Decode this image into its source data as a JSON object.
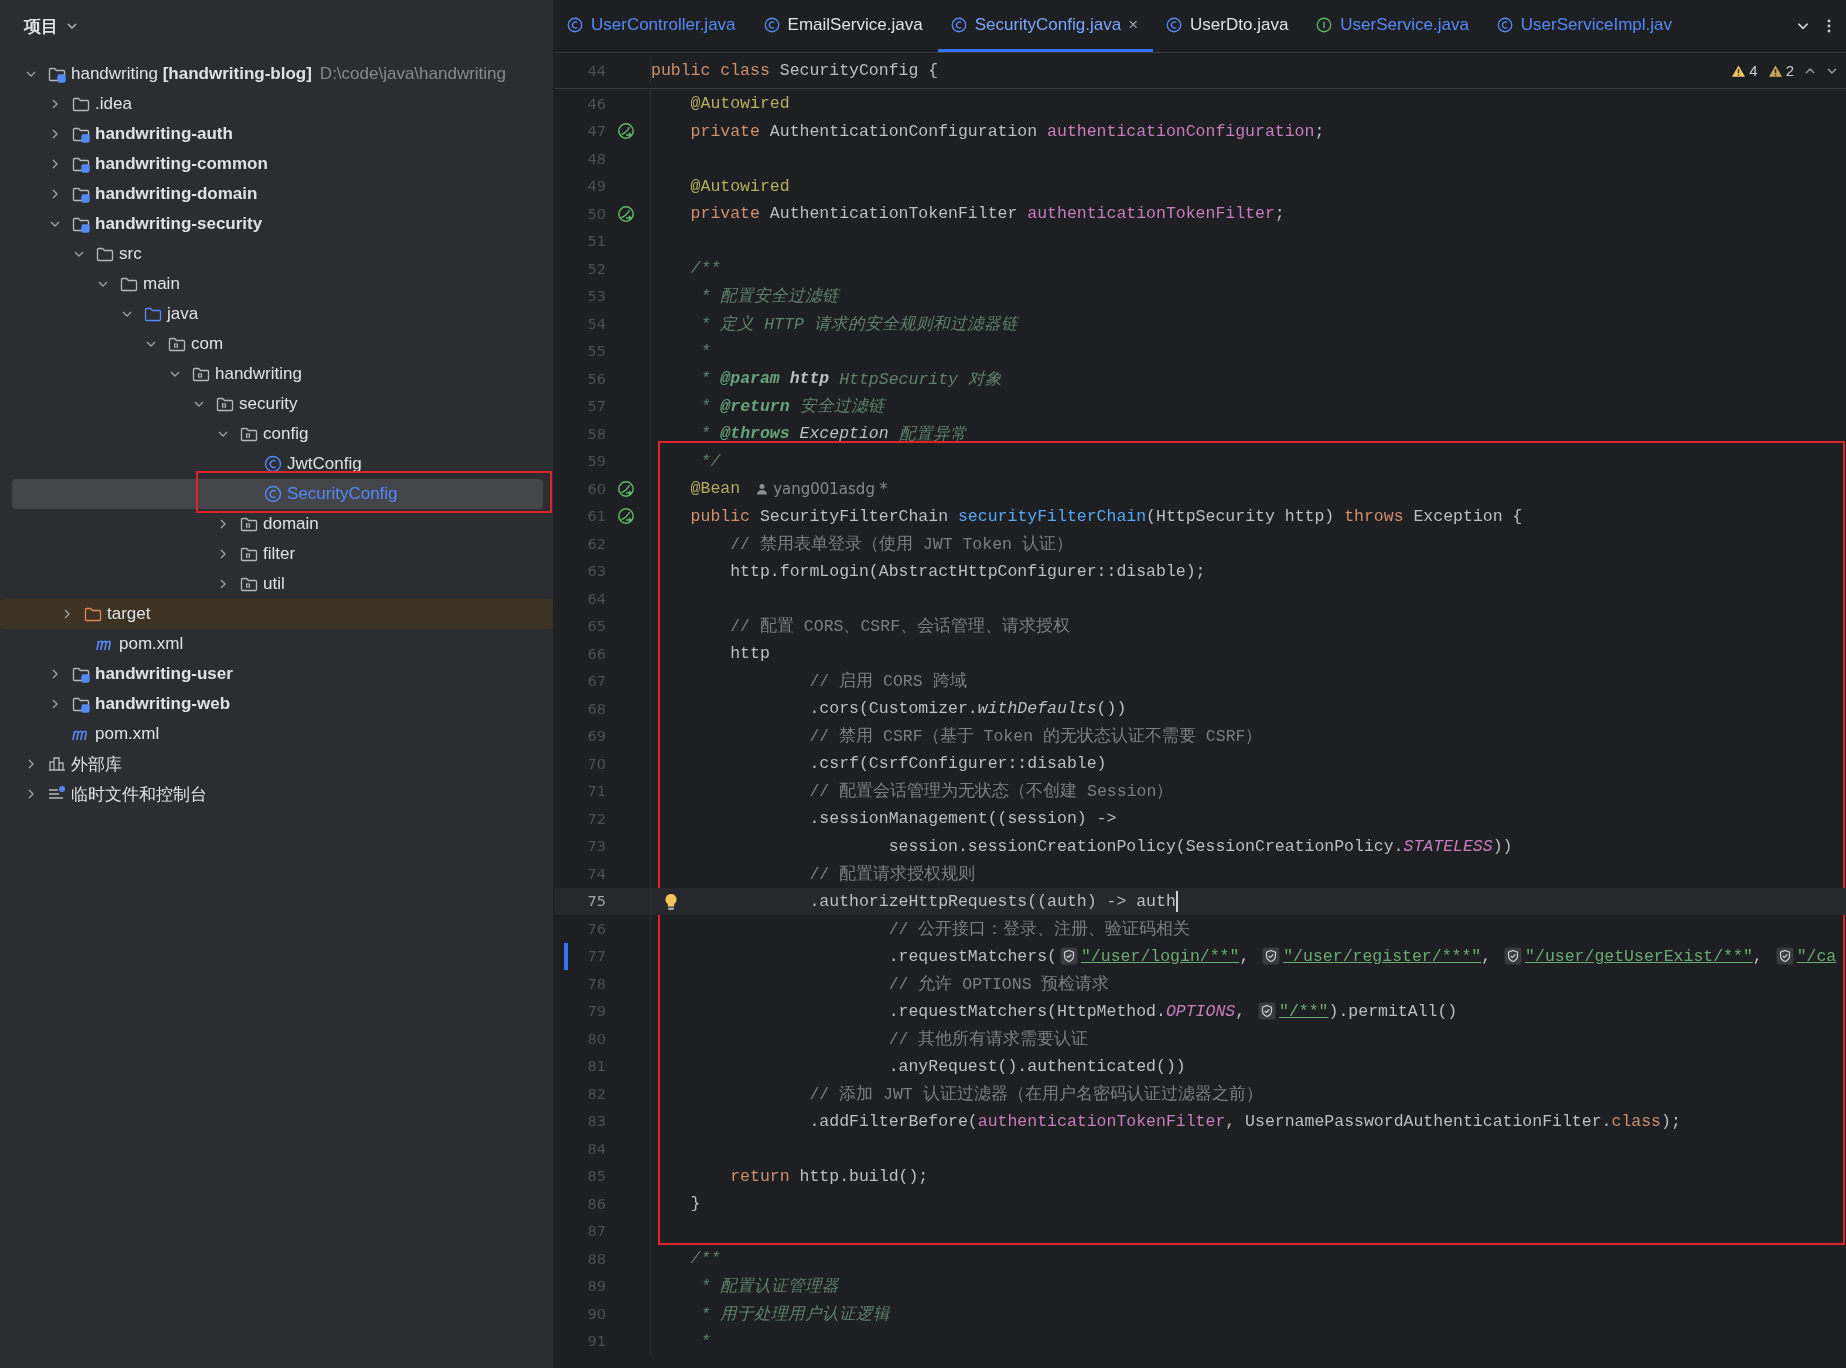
{
  "sidebar": {
    "title": "项目"
  },
  "tree": [
    {
      "label": "handwriting **[handwriting-blog]**",
      "path": "D:\\code\\java\\handwriting",
      "kind": "module",
      "bold": false,
      "selected": false,
      "marked": false,
      "expanded": true,
      "children": [
        {
          "label": ".idea",
          "kind": "folder",
          "bold": false,
          "selected": false,
          "marked": false,
          "expanded": false
        },
        {
          "label": "handwriting-auth",
          "kind": "module",
          "bold": true,
          "selected": false,
          "marked": false,
          "expanded": false
        },
        {
          "label": "handwriting-common",
          "kind": "module",
          "bold": true,
          "selected": false,
          "marked": false,
          "expanded": false
        },
        {
          "label": "handwriting-domain",
          "kind": "module",
          "bold": true,
          "selected": false,
          "marked": false,
          "expanded": false
        },
        {
          "label": "handwriting-security",
          "kind": "module",
          "bold": true,
          "selected": false,
          "marked": false,
          "expanded": true,
          "children": [
            {
              "label": "src",
              "kind": "folder",
              "bold": false,
              "selected": false,
              "marked": false,
              "expanded": true,
              "children": [
                {
                  "label": "main",
                  "kind": "folder",
                  "bold": false,
                  "selected": false,
                  "marked": false,
                  "expanded": true,
                  "children": [
                    {
                      "label": "java",
                      "kind": "source",
                      "bold": false,
                      "selected": false,
                      "marked": false,
                      "expanded": true,
                      "children": [
                        {
                          "label": "com",
                          "kind": "package",
                          "bold": false,
                          "selected": false,
                          "marked": false,
                          "expanded": true,
                          "children": [
                            {
                              "label": "handwriting",
                              "kind": "package",
                              "bold": false,
                              "selected": false,
                              "marked": false,
                              "expanded": true,
                              "children": [
                                {
                                  "label": "security",
                                  "kind": "package",
                                  "bold": false,
                                  "selected": false,
                                  "marked": false,
                                  "expanded": true,
                                  "children": [
                                    {
                                      "label": "config",
                                      "kind": "package",
                                      "bold": false,
                                      "selected": false,
                                      "marked": false,
                                      "expanded": true,
                                      "children": [
                                        {
                                          "label": "JwtConfig",
                                          "kind": "class",
                                          "bold": false,
                                          "selected": false,
                                          "marked": false
                                        },
                                        {
                                          "label": "SecurityConfig",
                                          "kind": "class",
                                          "bold": false,
                                          "selected": true,
                                          "marked": true
                                        }
                                      ]
                                    },
                                    {
                                      "label": "domain",
                                      "kind": "package",
                                      "bold": false,
                                      "selected": false,
                                      "marked": false,
                                      "expanded": false
                                    },
                                    {
                                      "label": "filter",
                                      "kind": "package",
                                      "bold": false,
                                      "selected": false,
                                      "marked": false,
                                      "expanded": false
                                    },
                                    {
                                      "label": "util",
                                      "kind": "package",
                                      "bold": false,
                                      "selected": false,
                                      "marked": false,
                                      "expanded": false
                                    }
                                  ]
                                }
                              ]
                            }
                          ]
                        }
                      ]
                    }
                  ]
                }
              ]
            },
            {
              "label": "target",
              "kind": "excluded",
              "bold": false,
              "selected": false,
              "marked": false,
              "expanded": false
            },
            {
              "label": "pom.xml",
              "kind": "maven",
              "bold": false,
              "selected": false,
              "marked": false
            }
          ]
        },
        {
          "label": "handwriting-user",
          "kind": "module",
          "bold": true,
          "selected": false,
          "marked": false,
          "expanded": false
        },
        {
          "label": "handwriting-web",
          "kind": "module",
          "bold": true,
          "selected": false,
          "marked": false,
          "expanded": false
        },
        {
          "label": "pom.xml",
          "kind": "maven",
          "bold": false,
          "selected": false,
          "marked": false
        }
      ]
    },
    {
      "label": "外部库",
      "kind": "library",
      "bold": false,
      "selected": false,
      "marked": false,
      "expanded": false
    },
    {
      "label": "临时文件和控制台",
      "kind": "scratch",
      "bold": false,
      "selected": false,
      "marked": false,
      "expanded": false
    }
  ],
  "tabs": [
    {
      "label": "UserController.java",
      "kind": "class",
      "selected": false
    },
    {
      "label": "EmailService.java",
      "kind": "class",
      "selected": false
    },
    {
      "label": "SecurityConfig.java",
      "kind": "class",
      "selected": true,
      "close": "×"
    },
    {
      "label": "UserDto.java",
      "kind": "class",
      "selected": false
    },
    {
      "label": "UserService.java",
      "kind": "interface",
      "selected": false
    },
    {
      "label": "UserServiceImpl.jav",
      "kind": "class",
      "selected": false
    }
  ],
  "inspections": [
    {
      "kind": "warning",
      "count": "4"
    },
    {
      "kind": "weak",
      "count": "2"
    }
  ],
  "sticky_line": {
    "number": "44",
    "tokens": [
      {
        "kind": "kw",
        "text": "public class "
      },
      {
        "kind": "plain",
        "text": "SecurityConfig {"
      }
    ]
  },
  "blocks": [
    {
      "marked": false,
      "lines": [
        {
          "number": "46",
          "tokens": [
            {
              "kind": "ann",
              "text": "    @Autowired"
            }
          ]
        },
        {
          "number": "47",
          "gutter_icon": {
            "kind": "bean"
          },
          "tokens": [
            {
              "kind": "kw",
              "text": "    private "
            },
            {
              "kind": "plain",
              "text": "AuthenticationConfiguration "
            },
            {
              "kind": "field",
              "text": "authenticationConfiguration"
            },
            {
              "kind": "plain",
              "text": ";"
            }
          ]
        },
        {
          "number": "48"
        },
        {
          "number": "49",
          "tokens": [
            {
              "kind": "ann",
              "text": "    @Autowired"
            }
          ]
        },
        {
          "number": "50",
          "gutter_icon": {
            "kind": "bean"
          },
          "tokens": [
            {
              "kind": "kw",
              "text": "    private "
            },
            {
              "kind": "plain",
              "text": "AuthenticationTokenFilter "
            },
            {
              "kind": "field",
              "text": "authenticationTokenFilter"
            },
            {
              "kind": "plain",
              "text": ";"
            }
          ]
        },
        {
          "number": "51"
        },
        {
          "number": "52",
          "tokens": [
            {
              "kind": "doc",
              "text": "    /**"
            }
          ]
        },
        {
          "number": "53",
          "tokens": [
            {
              "kind": "doc",
              "text": "     * 配置安全过滤链"
            }
          ]
        },
        {
          "number": "54",
          "tokens": [
            {
              "kind": "doc",
              "text": "     * 定义 HTTP 请求的安全规则和过滤器链"
            }
          ]
        },
        {
          "number": "55",
          "tokens": [
            {
              "kind": "doc",
              "text": "     *"
            }
          ]
        },
        {
          "number": "56",
          "tokens": [
            {
              "kind": "doc",
              "text": "     * "
            },
            {
              "kind": "doctag",
              "text": "@param"
            },
            {
              "kind": "docbold",
              "text": " http"
            },
            {
              "kind": "doc",
              "text": " HttpSecurity 对象"
            }
          ]
        },
        {
          "number": "57",
          "tokens": [
            {
              "kind": "doc",
              "text": "     * "
            },
            {
              "kind": "doctag",
              "text": "@return"
            },
            {
              "kind": "doc",
              "text": " 安全过滤链"
            }
          ]
        },
        {
          "number": "58",
          "tokens": [
            {
              "kind": "doc",
              "text": "     * "
            },
            {
              "kind": "doctag",
              "text": "@throws"
            },
            {
              "kind": "docref",
              "text": " Exception"
            },
            {
              "kind": "doc",
              "text": " 配置异常"
            }
          ]
        }
      ]
    },
    {
      "marked": true,
      "lines": [
        {
          "number": "59",
          "tokens": [
            {
              "kind": "doc",
              "text": "     */"
            }
          ]
        },
        {
          "number": "60",
          "gutter_icon": {
            "kind": "bean"
          },
          "tokens": [
            {
              "kind": "ann",
              "text": "    @Bean"
            },
            {
              "kind": "author",
              "text": "yang001asdg *"
            }
          ]
        },
        {
          "number": "61",
          "gutter_icon": {
            "kind": "bean"
          },
          "tokens": [
            {
              "kind": "kw",
              "text": "    public "
            },
            {
              "kind": "plain",
              "text": "SecurityFilterChain "
            },
            {
              "kind": "method",
              "text": "securityFilterChain"
            },
            {
              "kind": "plain",
              "text": "(HttpSecurity http) "
            },
            {
              "kind": "kw",
              "text": "throws "
            },
            {
              "kind": "plain",
              "text": "Exception {"
            }
          ]
        },
        {
          "number": "62",
          "tokens": [
            {
              "kind": "comment",
              "text": "        // 禁用表单登录（使用 JWT Token 认证）"
            }
          ]
        },
        {
          "number": "63",
          "tokens": [
            {
              "kind": "plain",
              "text": "        http.formLogin(AbstractHttpConfigurer::disable);"
            }
          ]
        },
        {
          "number": "64"
        },
        {
          "number": "65",
          "tokens": [
            {
              "kind": "comment",
              "text": "        // 配置 CORS、CSRF、会话管理、请求授权"
            }
          ]
        },
        {
          "number": "66",
          "tokens": [
            {
              "kind": "plain",
              "text": "        http"
            }
          ]
        },
        {
          "number": "67",
          "tokens": [
            {
              "kind": "comment",
              "text": "                // 启用 CORS 跨域"
            }
          ]
        },
        {
          "number": "68",
          "tokens": [
            {
              "kind": "plain",
              "text": "                .cors(Customizer."
            },
            {
              "kind": "italic",
              "text": "withDefaults"
            },
            {
              "kind": "plain",
              "text": "())"
            }
          ]
        },
        {
          "number": "69",
          "tokens": [
            {
              "kind": "comment",
              "text": "                // 禁用 CSRF（基于 Token 的无状态认证不需要 CSRF）"
            }
          ]
        },
        {
          "number": "70",
          "tokens": [
            {
              "kind": "plain",
              "text": "                .csrf(CsrfConfigurer::disable)"
            }
          ]
        },
        {
          "number": "71",
          "tokens": [
            {
              "kind": "comment",
              "text": "                // 配置会话管理为无状态（不创建 Session）"
            }
          ]
        },
        {
          "number": "72",
          "tokens": [
            {
              "kind": "plain",
              "text": "                .sessionManagement((session) ->"
            }
          ]
        },
        {
          "number": "73",
          "tokens": [
            {
              "kind": "plain",
              "text": "                        session.sessionCreationPolicy(SessionCreationPolicy."
            },
            {
              "kind": "constant",
              "text": "STATELESS"
            },
            {
              "kind": "plain",
              "text": "))"
            }
          ]
        },
        {
          "number": "74",
          "tokens": [
            {
              "kind": "comment",
              "text": "                // 配置请求授权规则"
            }
          ]
        },
        {
          "number": "75",
          "current": true,
          "gutter_icon": {
            "kind": "bulb"
          },
          "tokens": [
            {
              "kind": "plain",
              "text": "                .authorizeHttpRequests((auth) -> auth"
            }
          ]
        },
        {
          "number": "76",
          "tokens": [
            {
              "kind": "comment",
              "text": "                        // 公开接口：登录、注册、验证码相关"
            }
          ]
        },
        {
          "number": "77",
          "modified": true,
          "tokens": [
            {
              "kind": "plain",
              "text": "                        .requestMatchers("
            },
            {
              "kind": "shield"
            },
            {
              "kind": "url",
              "text": "\"/user/login/**\""
            },
            {
              "kind": "plain",
              "text": ", "
            },
            {
              "kind": "shield"
            },
            {
              "kind": "url",
              "text": "\"/user/register/***\""
            },
            {
              "kind": "plain",
              "text": ", "
            },
            {
              "kind": "shield"
            },
            {
              "kind": "url",
              "text": "\"/user/getUserExist/**\""
            },
            {
              "kind": "plain",
              "text": ", "
            },
            {
              "kind": "shield"
            },
            {
              "kind": "url",
              "text": "\"/ca"
            }
          ]
        },
        {
          "number": "78",
          "tokens": [
            {
              "kind": "comment",
              "text": "                        // 允许 OPTIONS 预检请求"
            }
          ]
        },
        {
          "number": "79",
          "tokens": [
            {
              "kind": "plain",
              "text": "                        .requestMatchers(HttpMethod."
            },
            {
              "kind": "constant",
              "text": "OPTIONS"
            },
            {
              "kind": "plain",
              "text": ", "
            },
            {
              "kind": "shield"
            },
            {
              "kind": "url",
              "text": "\"/**\""
            },
            {
              "kind": "plain",
              "text": ").permitAll()"
            }
          ]
        },
        {
          "number": "80",
          "tokens": [
            {
              "kind": "comment",
              "text": "                        // 其他所有请求需要认证"
            }
          ]
        },
        {
          "number": "81",
          "tokens": [
            {
              "kind": "plain",
              "text": "                        .anyRequest().authenticated())"
            }
          ]
        },
        {
          "number": "82",
          "tokens": [
            {
              "kind": "comment",
              "text": "                // 添加 JWT 认证过滤器（在用户名密码认证过滤器之前）"
            }
          ]
        },
        {
          "number": "83",
          "tokens": [
            {
              "kind": "plain",
              "text": "                .addFilterBefore("
            },
            {
              "kind": "field",
              "text": "authenticationTokenFilter"
            },
            {
              "kind": "plain",
              "text": ", UsernamePasswordAuthenticationFilter."
            },
            {
              "kind": "kw",
              "text": "class"
            },
            {
              "kind": "plain",
              "text": ");"
            }
          ]
        },
        {
          "number": "84"
        },
        {
          "number": "85",
          "tokens": [
            {
              "kind": "kw",
              "text": "        return "
            },
            {
              "kind": "plain",
              "text": "http.build();"
            }
          ]
        },
        {
          "number": "86",
          "tokens": [
            {
              "kind": "plain",
              "text": "    }"
            }
          ]
        },
        {
          "number": "87"
        }
      ]
    },
    {
      "marked": false,
      "lines": [
        {
          "number": "88",
          "tokens": [
            {
              "kind": "doc",
              "text": "    /**"
            }
          ]
        },
        {
          "number": "89",
          "tokens": [
            {
              "kind": "doc",
              "text": "     * 配置认证管理器"
            }
          ]
        },
        {
          "number": "90",
          "tokens": [
            {
              "kind": "doc",
              "text": "     * 用于处理用户认证逻辑"
            }
          ]
        },
        {
          "number": "91",
          "tokens": [
            {
              "kind": "doc",
              "text": "     *"
            }
          ]
        }
      ]
    }
  ]
}
